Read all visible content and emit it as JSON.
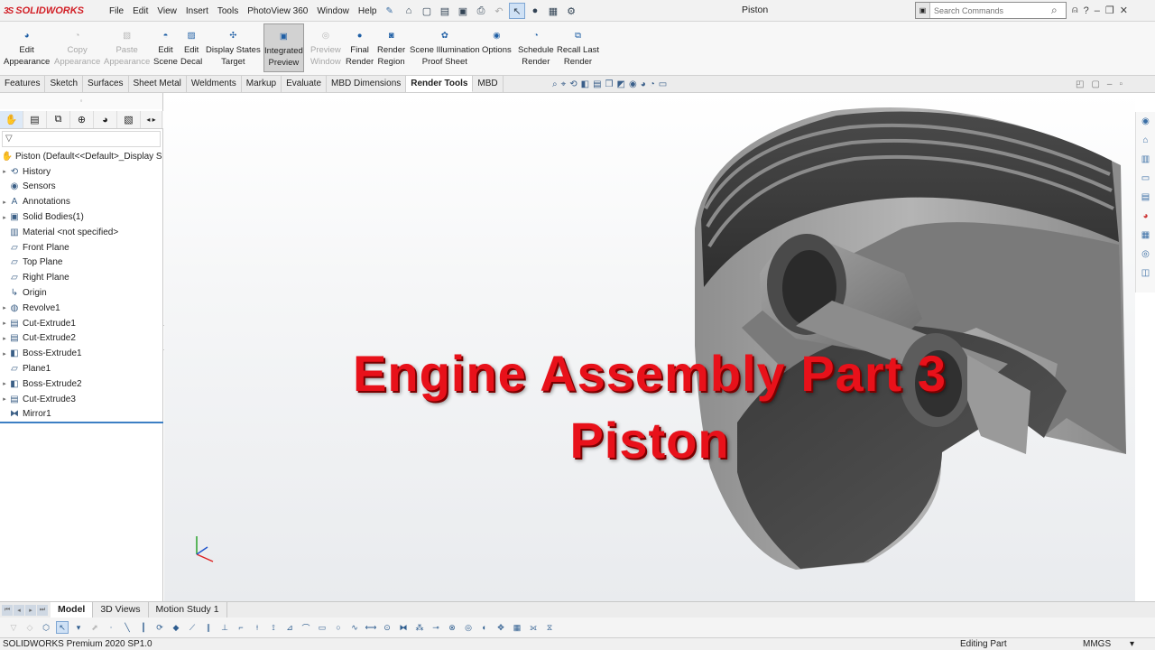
{
  "app": {
    "brand": "SOLIDWORKS",
    "doc_title": "Piston"
  },
  "menu": [
    "File",
    "Edit",
    "View",
    "Insert",
    "Tools",
    "PhotoView 360",
    "Window",
    "Help"
  ],
  "search": {
    "placeholder": "Search Commands"
  },
  "ribbon": [
    {
      "line1": "Edit",
      "line2": "Appearance",
      "icon": "appearance-icon",
      "state": "enabled"
    },
    {
      "line1": "Copy",
      "line2": "Appearance",
      "icon": "copy-appearance-icon",
      "state": "disabled"
    },
    {
      "line1": "Paste",
      "line2": "Appearance",
      "icon": "paste-appearance-icon",
      "state": "disabled"
    },
    {
      "line1": "Edit",
      "line2": "Scene",
      "icon": "scene-icon",
      "state": "enabled"
    },
    {
      "line1": "Edit",
      "line2": "Decal",
      "icon": "decal-icon",
      "state": "enabled"
    },
    {
      "line1": "Display States",
      "line2": "Target",
      "icon": "display-states-icon",
      "state": "enabled"
    },
    {
      "line1": "Integrated",
      "line2": "Preview",
      "icon": "integrated-preview-icon",
      "state": "active"
    },
    {
      "line1": "Preview",
      "line2": "Window",
      "icon": "preview-window-icon",
      "state": "disabled"
    },
    {
      "line1": "Final",
      "line2": "Render",
      "icon": "final-render-icon",
      "state": "enabled"
    },
    {
      "line1": "Render",
      "line2": "Region",
      "icon": "render-region-icon",
      "state": "enabled"
    },
    {
      "line1": "Scene Illumination",
      "line2": "Proof Sheet",
      "icon": "proof-sheet-icon",
      "state": "enabled"
    },
    {
      "line1": "Options",
      "line2": "",
      "icon": "options-icon",
      "state": "enabled"
    },
    {
      "line1": "Schedule",
      "line2": "Render",
      "icon": "schedule-render-icon",
      "state": "enabled"
    },
    {
      "line1": "Recall Last",
      "line2": "Render",
      "icon": "recall-render-icon",
      "state": "enabled"
    }
  ],
  "tabs": [
    {
      "label": "Features",
      "active": false
    },
    {
      "label": "Sketch",
      "active": false
    },
    {
      "label": "Surfaces",
      "active": false
    },
    {
      "label": "Sheet Metal",
      "active": false
    },
    {
      "label": "Weldments",
      "active": false
    },
    {
      "label": "Markup",
      "active": false
    },
    {
      "label": "Evaluate",
      "active": false
    },
    {
      "label": "MBD Dimensions",
      "active": false
    },
    {
      "label": "Render Tools",
      "active": true
    },
    {
      "label": "MBD",
      "active": false
    }
  ],
  "tree": {
    "root": "Piston  (Default<<Default>_Display S",
    "items": [
      {
        "label": "History",
        "icon": "history-icon",
        "expand": true
      },
      {
        "label": "Sensors",
        "icon": "sensors-icon",
        "expand": false
      },
      {
        "label": "Annotations",
        "icon": "annotations-icon",
        "expand": true
      },
      {
        "label": "Solid Bodies(1)",
        "icon": "solid-bodies-icon",
        "expand": true
      },
      {
        "label": "Material <not specified>",
        "icon": "material-icon",
        "expand": false
      },
      {
        "label": "Front Plane",
        "icon": "plane-icon",
        "expand": false
      },
      {
        "label": "Top Plane",
        "icon": "plane-icon",
        "expand": false
      },
      {
        "label": "Right Plane",
        "icon": "plane-icon",
        "expand": false
      },
      {
        "label": "Origin",
        "icon": "origin-icon",
        "expand": false
      },
      {
        "label": "Revolve1",
        "icon": "revolve-icon",
        "expand": true
      },
      {
        "label": "Cut-Extrude1",
        "icon": "cut-extrude-icon",
        "expand": true
      },
      {
        "label": "Cut-Extrude2",
        "icon": "cut-extrude-icon",
        "expand": true
      },
      {
        "label": "Boss-Extrude1",
        "icon": "boss-extrude-icon",
        "expand": true
      },
      {
        "label": "Plane1",
        "icon": "plane-icon",
        "expand": false
      },
      {
        "label": "Boss-Extrude2",
        "icon": "boss-extrude-icon",
        "expand": true
      },
      {
        "label": "Cut-Extrude3",
        "icon": "cut-extrude-icon",
        "expand": true
      },
      {
        "label": "Mirror1",
        "icon": "mirror-icon",
        "expand": false
      }
    ]
  },
  "overlay": {
    "line1": "Engine Assembly Part 3",
    "line2": "Piston"
  },
  "bottom_tabs": [
    {
      "label": "Model",
      "active": true
    },
    {
      "label": "3D Views",
      "active": false
    },
    {
      "label": "Motion Study 1",
      "active": false
    }
  ],
  "status": {
    "left": "SOLIDWORKS Premium 2020 SP1.0",
    "mode": "Editing Part",
    "units": "MMGS",
    "caret": "▾"
  },
  "colors": {
    "title_red": "#e8111a",
    "accent_blue": "#3c7fc4",
    "brand_red": "#d21f26"
  }
}
